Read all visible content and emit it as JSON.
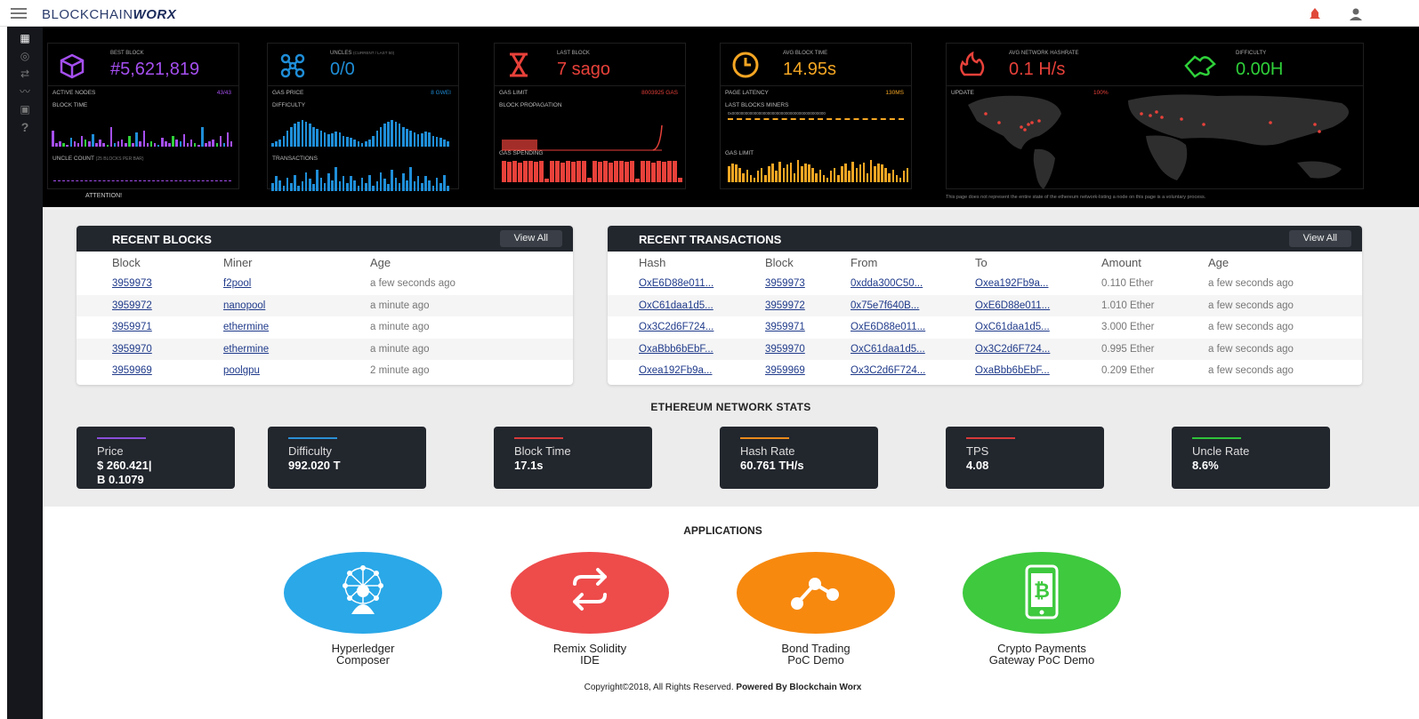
{
  "header": {
    "logo_plain": "BLOCKCHAIN",
    "logo_bold": "WORX"
  },
  "sidebar": {
    "icons": [
      "dashboard-icon",
      "gauge-icon",
      "transfer-icon",
      "route-icon",
      "document-icon",
      "help-icon"
    ]
  },
  "dashboard": {
    "best_block": {
      "label": "BEST BLOCK",
      "value": "#5,621,819"
    },
    "uncles": {
      "label": "UNCLES",
      "sub": "(CURRENT / LAST 50)",
      "value": "0/0"
    },
    "last_block": {
      "label": "LAST BLOCK",
      "value": "7 sago"
    },
    "avg_block_time": {
      "label": "AVG BLOCK TIME",
      "value": "14.95s"
    },
    "avg_hashrate": {
      "label": "AVG NETWORK HASHRATE",
      "value": "0.1 H/s"
    },
    "difficulty": {
      "label": "DIFFICULTY",
      "value": "0.00H"
    },
    "active_nodes": {
      "label": "ACTIVE NODES",
      "value": "43/43"
    },
    "gas_price": {
      "label": "GAS PRICE",
      "value": "8 gwei"
    },
    "gas_limit": {
      "label": "GAS LIMIT",
      "value": "8003925 gas"
    },
    "page_latency": {
      "label": "PAGE LATENCY",
      "value": "130ms"
    },
    "update": {
      "label": "UPDATE",
      "value": "100%"
    },
    "block_time_label": "BLOCK TIME",
    "difficulty_chart_label": "DIFFICULTY",
    "block_propagation_label": "BLOCK PROPAGATION",
    "last_blocks_miners_label": "LAST BLOCKS MINERS",
    "miners_hash": "0x000000000000000000000000000000000000000000",
    "uncle_count_label": "UNCLE COUNT",
    "uncle_count_sub": "(25 BLOCKS PER BAR)",
    "transactions_label": "TRANSACTIONS",
    "gas_spending_label": "GAS SPENDING",
    "gas_limit_chart_label": "GAS LIMIT",
    "attention": "ATTENTION!",
    "note": "This page does not represent the entire state of the ethereum network-listing a node on this page is a voluntary process."
  },
  "recent_blocks": {
    "title": "RECENT BLOCKS",
    "view_all": "View All",
    "columns": [
      "Block",
      "Miner",
      "Age"
    ],
    "rows": [
      [
        "3959973",
        "f2pool",
        "a few seconds ago"
      ],
      [
        "3959972",
        "nanopool",
        "a minute ago"
      ],
      [
        "3959971",
        "ethermine",
        "a minute ago"
      ],
      [
        "3959970",
        "ethermine",
        "a minute ago"
      ],
      [
        "3959969",
        "poolgpu",
        "2 minute ago"
      ]
    ]
  },
  "recent_transactions": {
    "title": "RECENT TRANSACTIONS",
    "view_all": "View All",
    "columns": [
      "Hash",
      "Block",
      "From",
      "To",
      "Amount",
      "Age"
    ],
    "rows": [
      [
        "OxE6D88e011...",
        "3959973",
        "0xdda300C50...",
        "Oxea192Fb9a...",
        "0.110 Ether",
        "a few seconds ago"
      ],
      [
        "OxC61daa1d5...",
        "3959972",
        "0x75e7f640B...",
        "OxE6D88e011...",
        "1.010 Ether",
        "a few seconds ago"
      ],
      [
        "Ox3C2d6F724...",
        "3959971",
        "OxE6D88e011...",
        "OxC61daa1d5...",
        "3.000 Ether",
        "a few seconds ago"
      ],
      [
        "OxaBbb6bEbF...",
        "3959970",
        "OxC61daa1d5...",
        "Ox3C2d6F724...",
        "0.995 Ether",
        "a few seconds ago"
      ],
      [
        "Oxea192Fb9a...",
        "3959969",
        "Ox3C2d6F724...",
        "OxaBbb6bEbF...",
        "0.209 Ether",
        "a few seconds ago"
      ]
    ]
  },
  "network_stats": {
    "title": "ETHEREUM NETWORK STATS",
    "items": [
      {
        "label": "Price",
        "value": "$ 260.421|",
        "value2": "B 0.1079",
        "color": "#8a4fd8"
      },
      {
        "label": "Difficulty",
        "value": "992.020 T",
        "value2": "",
        "color": "#2a8fd4"
      },
      {
        "label": "Block Time",
        "value": "17.1s",
        "value2": "",
        "color": "#d63a3a"
      },
      {
        "label": "Hash Rate",
        "value": "60.761 TH/s",
        "value2": "",
        "color": "#e98a1a"
      },
      {
        "label": "TPS",
        "value": "4.08",
        "value2": "",
        "color": "#d63a3a"
      },
      {
        "label": "Uncle Rate",
        "value": "8.6%",
        "value2": "",
        "color": "#2fc23a"
      }
    ]
  },
  "applications": {
    "title": "APPLICATIONS",
    "items": [
      {
        "line1": "Hyperledger",
        "line2": "Composer",
        "color": "#2aa8e8",
        "icon": "network-user-icon"
      },
      {
        "line1": "Remix Solidity",
        "line2": "IDE",
        "color": "#ee4b4b",
        "icon": "exchange-arrows-icon"
      },
      {
        "line1": "Bond Trading",
        "line2": "PoC Demo",
        "color": "#f7890f",
        "icon": "share-nodes-icon"
      },
      {
        "line1": "Crypto Payments",
        "line2": "Gateway PoC Demo",
        "color": "#3ec93e",
        "icon": "mobile-bitcoin-icon"
      }
    ]
  },
  "footer": {
    "text": "Copyright©2018, All Rights Reserved. ",
    "powered": "Powered By Blockchain Worx"
  },
  "colors": {
    "purple": "#a54ff0",
    "blue": "#1f8ed8",
    "red": "#e8413a",
    "orange": "#f5a623",
    "green": "#2fd03a"
  }
}
